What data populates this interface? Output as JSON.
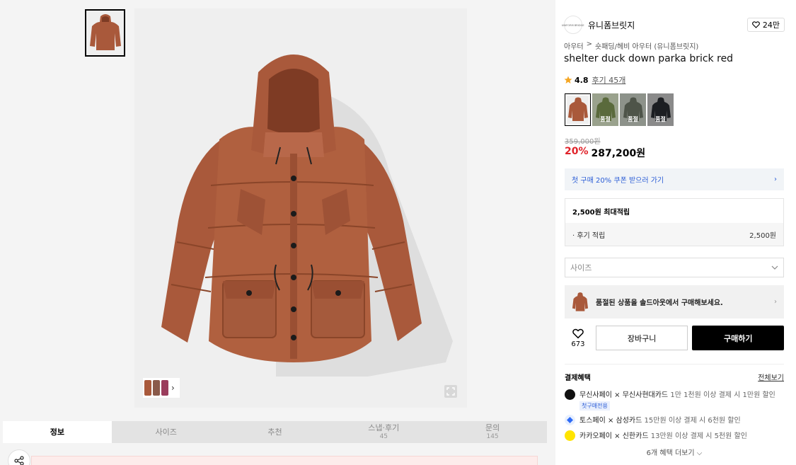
{
  "gallery": {
    "colors": {
      "jacket": "#a9593b",
      "jacket_dark": "#7e3b24",
      "bg": "#efefef"
    }
  },
  "tabs": [
    {
      "label": "정보",
      "count": ""
    },
    {
      "label": "사이즈",
      "count": ""
    },
    {
      "label": "추천",
      "count": ""
    },
    {
      "label": "스냅·후기",
      "count": "45"
    },
    {
      "label": "문의",
      "count": "145"
    }
  ],
  "brand": {
    "name": "유니폼브릿지",
    "logo_text": "UNIFORM BRIDGE",
    "likes": "24만"
  },
  "breadcrumb": {
    "category": "아우터",
    "separator": ">",
    "subcategory": "숏패딩/헤비 아우터 (유니폼브릿지)"
  },
  "product": {
    "title": "shelter duck down parka brick red",
    "rating": "4.8",
    "reviews": "후기 45개",
    "original_price": "359,000원",
    "discount": "20%",
    "price": "287,200원",
    "color_options": [
      {
        "color": "#a9593b",
        "sold_label": "",
        "selected": true
      },
      {
        "color": "#5a6a3c",
        "sold_label": "품절"
      },
      {
        "color": "#5b6256",
        "sold_label": "품절"
      },
      {
        "color": "#1c1e22",
        "sold_label": "품절"
      }
    ]
  },
  "coupon": {
    "text": "첫 구매 20% 쿠폰 받으러 가기",
    "accent": "#2a5cd6"
  },
  "points": {
    "max_label": "2,500원 최대적립",
    "review_label": "· 후기 적립",
    "review_value": "2,500원"
  },
  "size_select": {
    "placeholder": "사이즈"
  },
  "soldout": {
    "text": "품절된 상품을 솔드아웃에서 구매해보세요."
  },
  "actions": {
    "wish_count": "673",
    "cart": "장바구니",
    "buy": "구매하기"
  },
  "benefits": {
    "title": "결제혜택",
    "view_all": "전체보기",
    "items": [
      {
        "partner": "무신사페이 × 무신사현대카드",
        "desc": "1만 1천원 이상 결제 시 1만원 할인",
        "tag": "첫구매전용",
        "icon_color": "#111111"
      },
      {
        "partner": "토스페이 × 삼성카드",
        "desc": "15만원 이상 결제 시 6천원 할인",
        "tag": "",
        "icon_color": "#2f6cf6"
      },
      {
        "partner": "카카오페이 × 신한카드",
        "desc": "13만원 이상 결제 시 5천원 할인",
        "tag": "",
        "icon_color": "#ffe400"
      }
    ],
    "more": "6개 혜택 더보기"
  }
}
